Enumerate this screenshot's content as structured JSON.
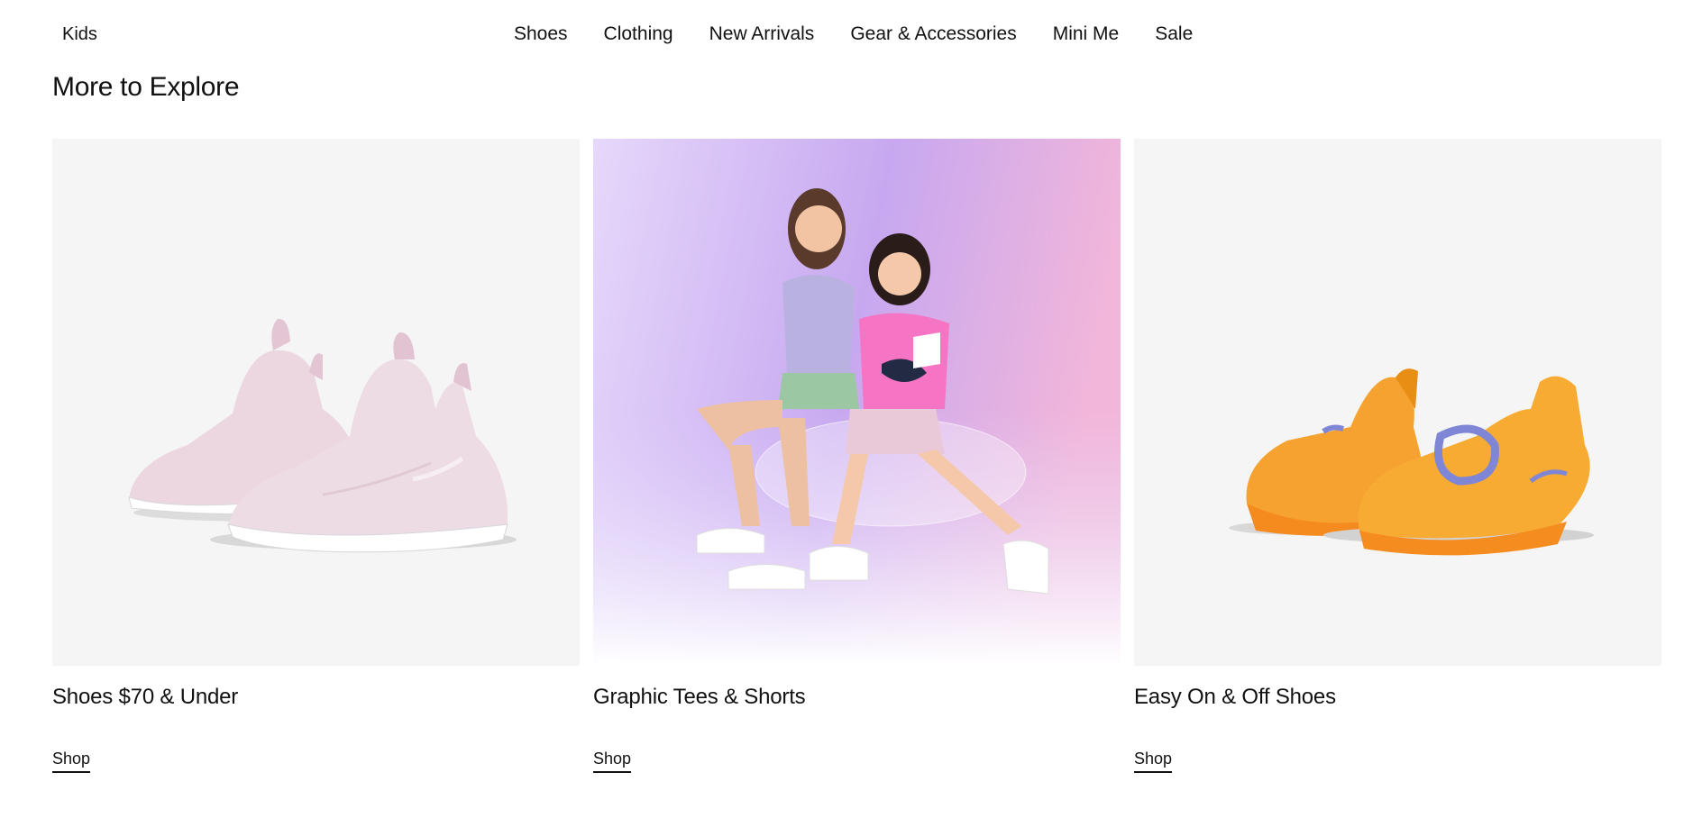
{
  "nav": {
    "brand": "Kids",
    "items": [
      {
        "label": "Shoes"
      },
      {
        "label": "Clothing"
      },
      {
        "label": "New Arrivals"
      },
      {
        "label": "Gear & Accessories"
      },
      {
        "label": "Mini Me"
      },
      {
        "label": "Sale"
      }
    ]
  },
  "section": {
    "title": "More to Explore"
  },
  "cards": [
    {
      "title": "Shoes $70 & Under",
      "link": "Shop",
      "image": "pink-kids-slip-on-shoes"
    },
    {
      "title": "Graphic Tees & Shorts",
      "link": "Shop",
      "image": "two-girls-on-clear-chair"
    },
    {
      "title": "Easy On & Off Shoes",
      "link": "Shop",
      "image": "orange-toddler-shoes"
    }
  ],
  "colors": {
    "text": "#111111",
    "card_bg": "#f5f5f5",
    "pink_shoe": "#ead6e0",
    "orange_shoe": "#f5a12c",
    "lavender": "#d6c3f5"
  }
}
